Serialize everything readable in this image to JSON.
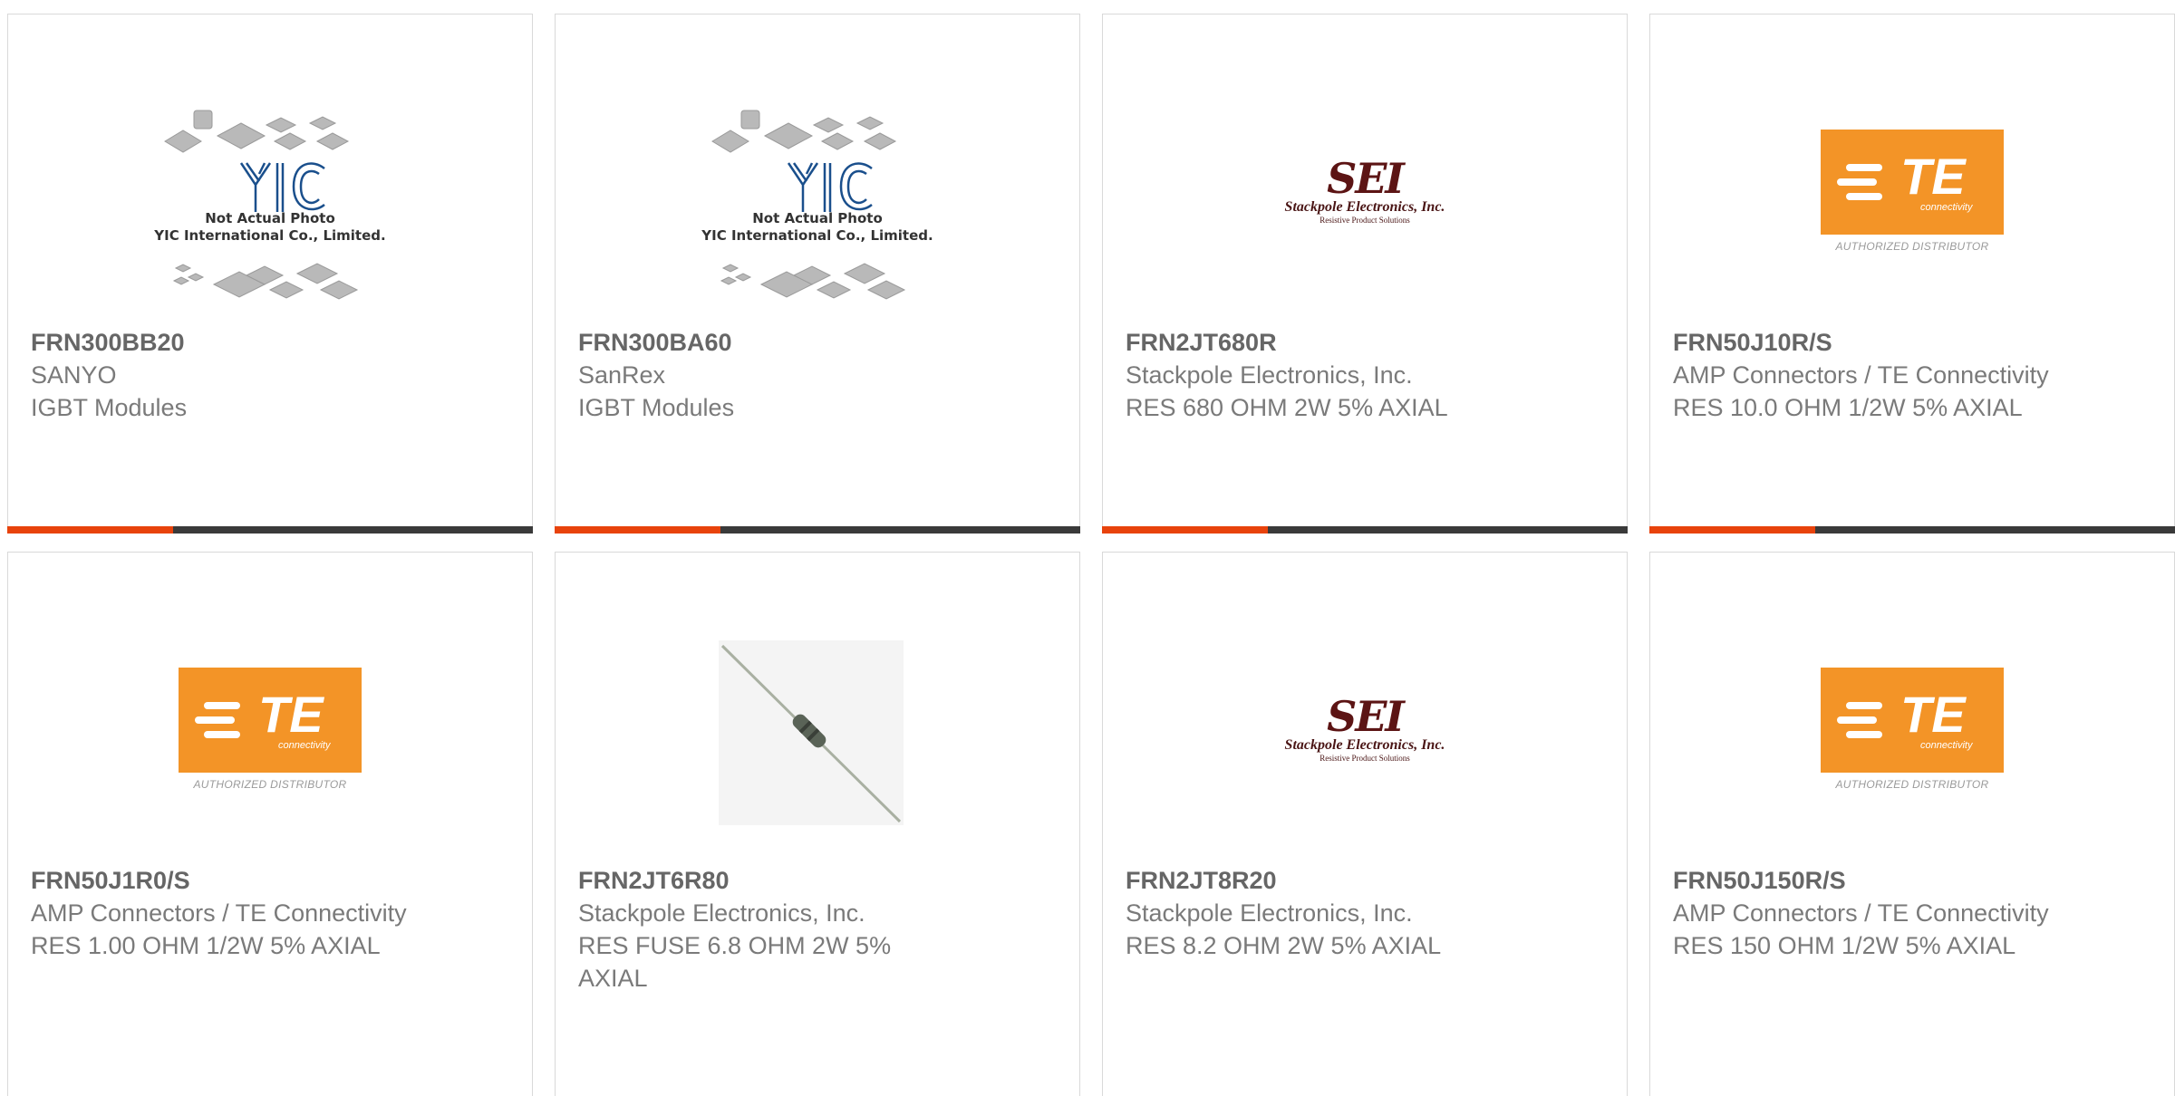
{
  "products": [
    {
      "part": "FRN300BB20",
      "manufacturer": "SANYO",
      "description": "IGBT Modules",
      "image": "yic-placeholder"
    },
    {
      "part": "FRN300BA60",
      "manufacturer": "SanRex",
      "description": "IGBT Modules",
      "image": "yic-placeholder"
    },
    {
      "part": "FRN2JT680R",
      "manufacturer": "Stackpole Electronics, Inc.",
      "description": "RES 680 OHM 2W 5% AXIAL",
      "image": "sei-logo"
    },
    {
      "part": "FRN50J10R/S",
      "manufacturer": "AMP Connectors / TE Connectivity",
      "description": "RES 10.0 OHM 1/2W 5% AXIAL",
      "image": "te-logo"
    },
    {
      "part": "FRN50J1R0/S",
      "manufacturer": "AMP Connectors / TE Connectivity",
      "description": "RES 1.00 OHM 1/2W 5% AXIAL",
      "image": "te-logo"
    },
    {
      "part": "FRN2JT6R80",
      "manufacturer": "Stackpole Electronics, Inc.",
      "description": "RES FUSE 6.8 OHM 2W 5% AXIAL",
      "image": "axial-resistor-photo"
    },
    {
      "part": "FRN2JT8R20",
      "manufacturer": "Stackpole Electronics, Inc.",
      "description": "RES 8.2 OHM 2W 5% AXIAL",
      "image": "sei-logo"
    },
    {
      "part": "FRN50J150R/S",
      "manufacturer": "AMP Connectors / TE Connectivity",
      "description": "RES 150 OHM 1/2W 5% AXIAL",
      "image": "te-logo"
    }
  ],
  "image_text": {
    "yic_line1": "Not Actual Photo",
    "yic_line2": "YIC International Co., Limited.",
    "sei_big": "SEI",
    "sei_line": "Stackpole Electronics, Inc.",
    "sei_small": "Resistive Product Solutions",
    "te_mark": "TE",
    "te_sub": "connectivity",
    "te_dist": "AUTHORIZED DISTRIBUTOR"
  },
  "colors": {
    "accent": "#e8430c",
    "accent_dark": "#3a3a3a",
    "te_orange": "#f39427",
    "sei_red": "#5c1414"
  }
}
